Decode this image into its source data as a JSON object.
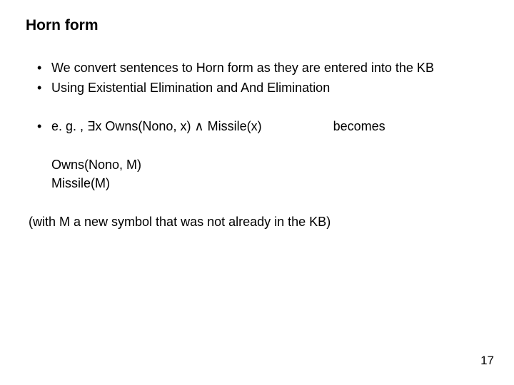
{
  "title": "Horn form",
  "bullets": {
    "b1": "We convert sentences to Horn form as they are entered into the KB",
    "b2": "Using Existential Elimination and And Elimination",
    "b3_left": "e. g. , ∃x Owns(Nono, x) ∧ Missile(x)",
    "b3_right": "becomes"
  },
  "result": {
    "line1": "Owns(Nono, M)",
    "line2": "Missile(M)"
  },
  "note": "(with M a new symbol that was not already in the KB)",
  "page_number": "17"
}
